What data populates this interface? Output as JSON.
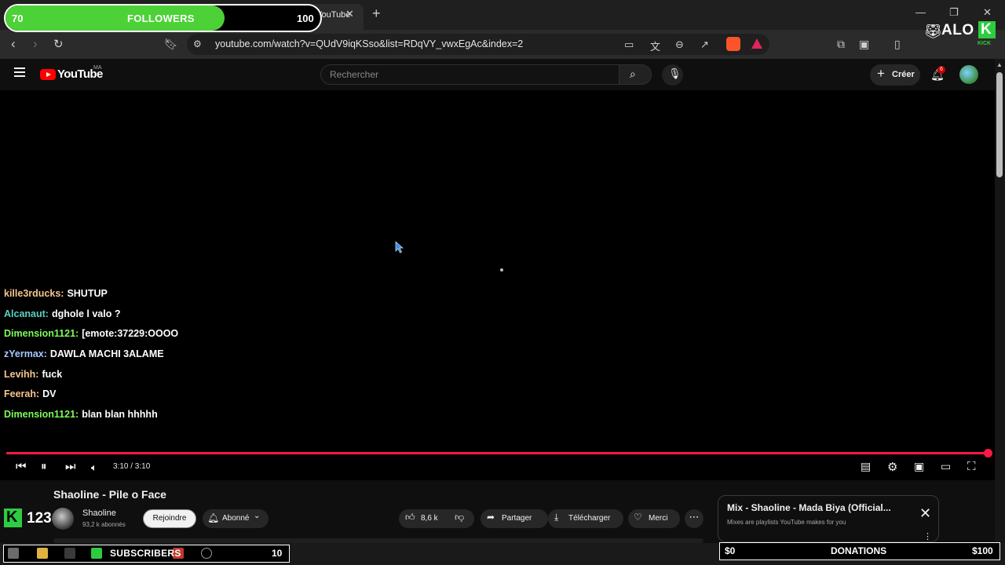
{
  "browser": {
    "tab_title": "Shaoline - Pile o Face - YouTube",
    "url": "youtube.com/watch?v=QUdV9iqKSso&list=RDqVY_vwxEgAc&index=2"
  },
  "youtube": {
    "logo_text": "YouTube",
    "country_code": "MA",
    "search_placeholder": "Rechercher",
    "create_label": "Créer",
    "notification_count": "6"
  },
  "chat": [
    {
      "user": "kille3rducks:",
      "message": "SHUTUP",
      "color": "#f5c58e"
    },
    {
      "user": "Alcanaut:",
      "message": "dghole l valo ?",
      "color": "#5ad1c0"
    },
    {
      "user": "Dimension1121:",
      "message": "[emote:37229:OOOO",
      "color": "#7cfc5a"
    },
    {
      "user": "zYermax:",
      "message": "DAWLA MACHI 3ALAME",
      "color": "#a9c8ff"
    },
    {
      "user": "Levihh:",
      "message": "fuck",
      "color": "#f5c58e"
    },
    {
      "user": "Feerah:",
      "message": "DV",
      "color": "#f5c58e"
    },
    {
      "user": "Dimension1121:",
      "message": "blan blan hhhhh",
      "color": "#7cfc5a"
    }
  ],
  "player": {
    "time": "3:10 / 3:10",
    "progress": 1.0
  },
  "video": {
    "title": "Shaoline - Pile o Face",
    "channel": "Shaoline",
    "subscribers": "93,2 k abonnés",
    "join_label": "Rejoindre",
    "subscribed_label": "Abonné",
    "likes": "8,6 k",
    "share_label": "Partager",
    "download_label": "Télécharger",
    "thanks_label": "Merci"
  },
  "mix": {
    "title": "Mix - Shaoline - Mada Biya (Official...",
    "subtitle": "Mixes are playlists YouTube makes for you"
  },
  "overlay": {
    "followers_current": "70",
    "followers_label": "FOLLOWERS",
    "followers_goal": "100",
    "followers_fraction": 0.7,
    "brand_word": "ALO",
    "brand_k": "K",
    "brand_sub": "KICK",
    "kick_letter": "K",
    "kick_count": "123",
    "subscribers_label": "SUBSCRIBERS",
    "subscribers_goal": "10",
    "donations_current": "$0",
    "donations_label": "DONATIONS",
    "donations_goal": "$100"
  },
  "colors": {
    "progress_red": "#ff1744",
    "kick_green": "#2ecc40",
    "followers_green": "#4cd137"
  }
}
